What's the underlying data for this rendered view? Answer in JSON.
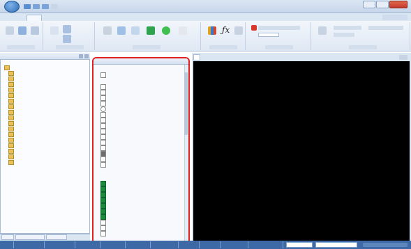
{
  "window": {
    "title": ""
  },
  "tabs": [
    "",
    "",
    "",
    "",
    ""
  ],
  "explorer": {
    "items": [
      "",
      "",
      "",
      "",
      "",
      "",
      "",
      "",
      "",
      "",
      "",
      "",
      "",
      "",
      "",
      "",
      "",
      ""
    ],
    "bottom_tabs": [
      "",
      "",
      ""
    ]
  },
  "toolbox": {
    "title": "",
    "section_1": "",
    "section_2": "",
    "section_3": "",
    "select_tools": [
      ""
    ],
    "shape_tools": [
      "",
      "",
      "",
      "",
      "",
      "",
      "",
      "",
      "",
      "",
      "",
      "",
      "",
      "",
      ""
    ],
    "switch_tools": [
      "",
      "",
      "",
      "",
      "",
      "",
      "",
      "",
      "",
      ""
    ]
  },
  "document": {
    "tab_label": ""
  },
  "status_bar": [
    "",
    "",
    "",
    "",
    "",
    "",
    "",
    "",
    "",
    "",
    ""
  ],
  "colors": {
    "accent": "#3d6aa6",
    "canvas": "#000000",
    "highlight": "#e02020",
    "green_tool": "#1b8a3d"
  }
}
